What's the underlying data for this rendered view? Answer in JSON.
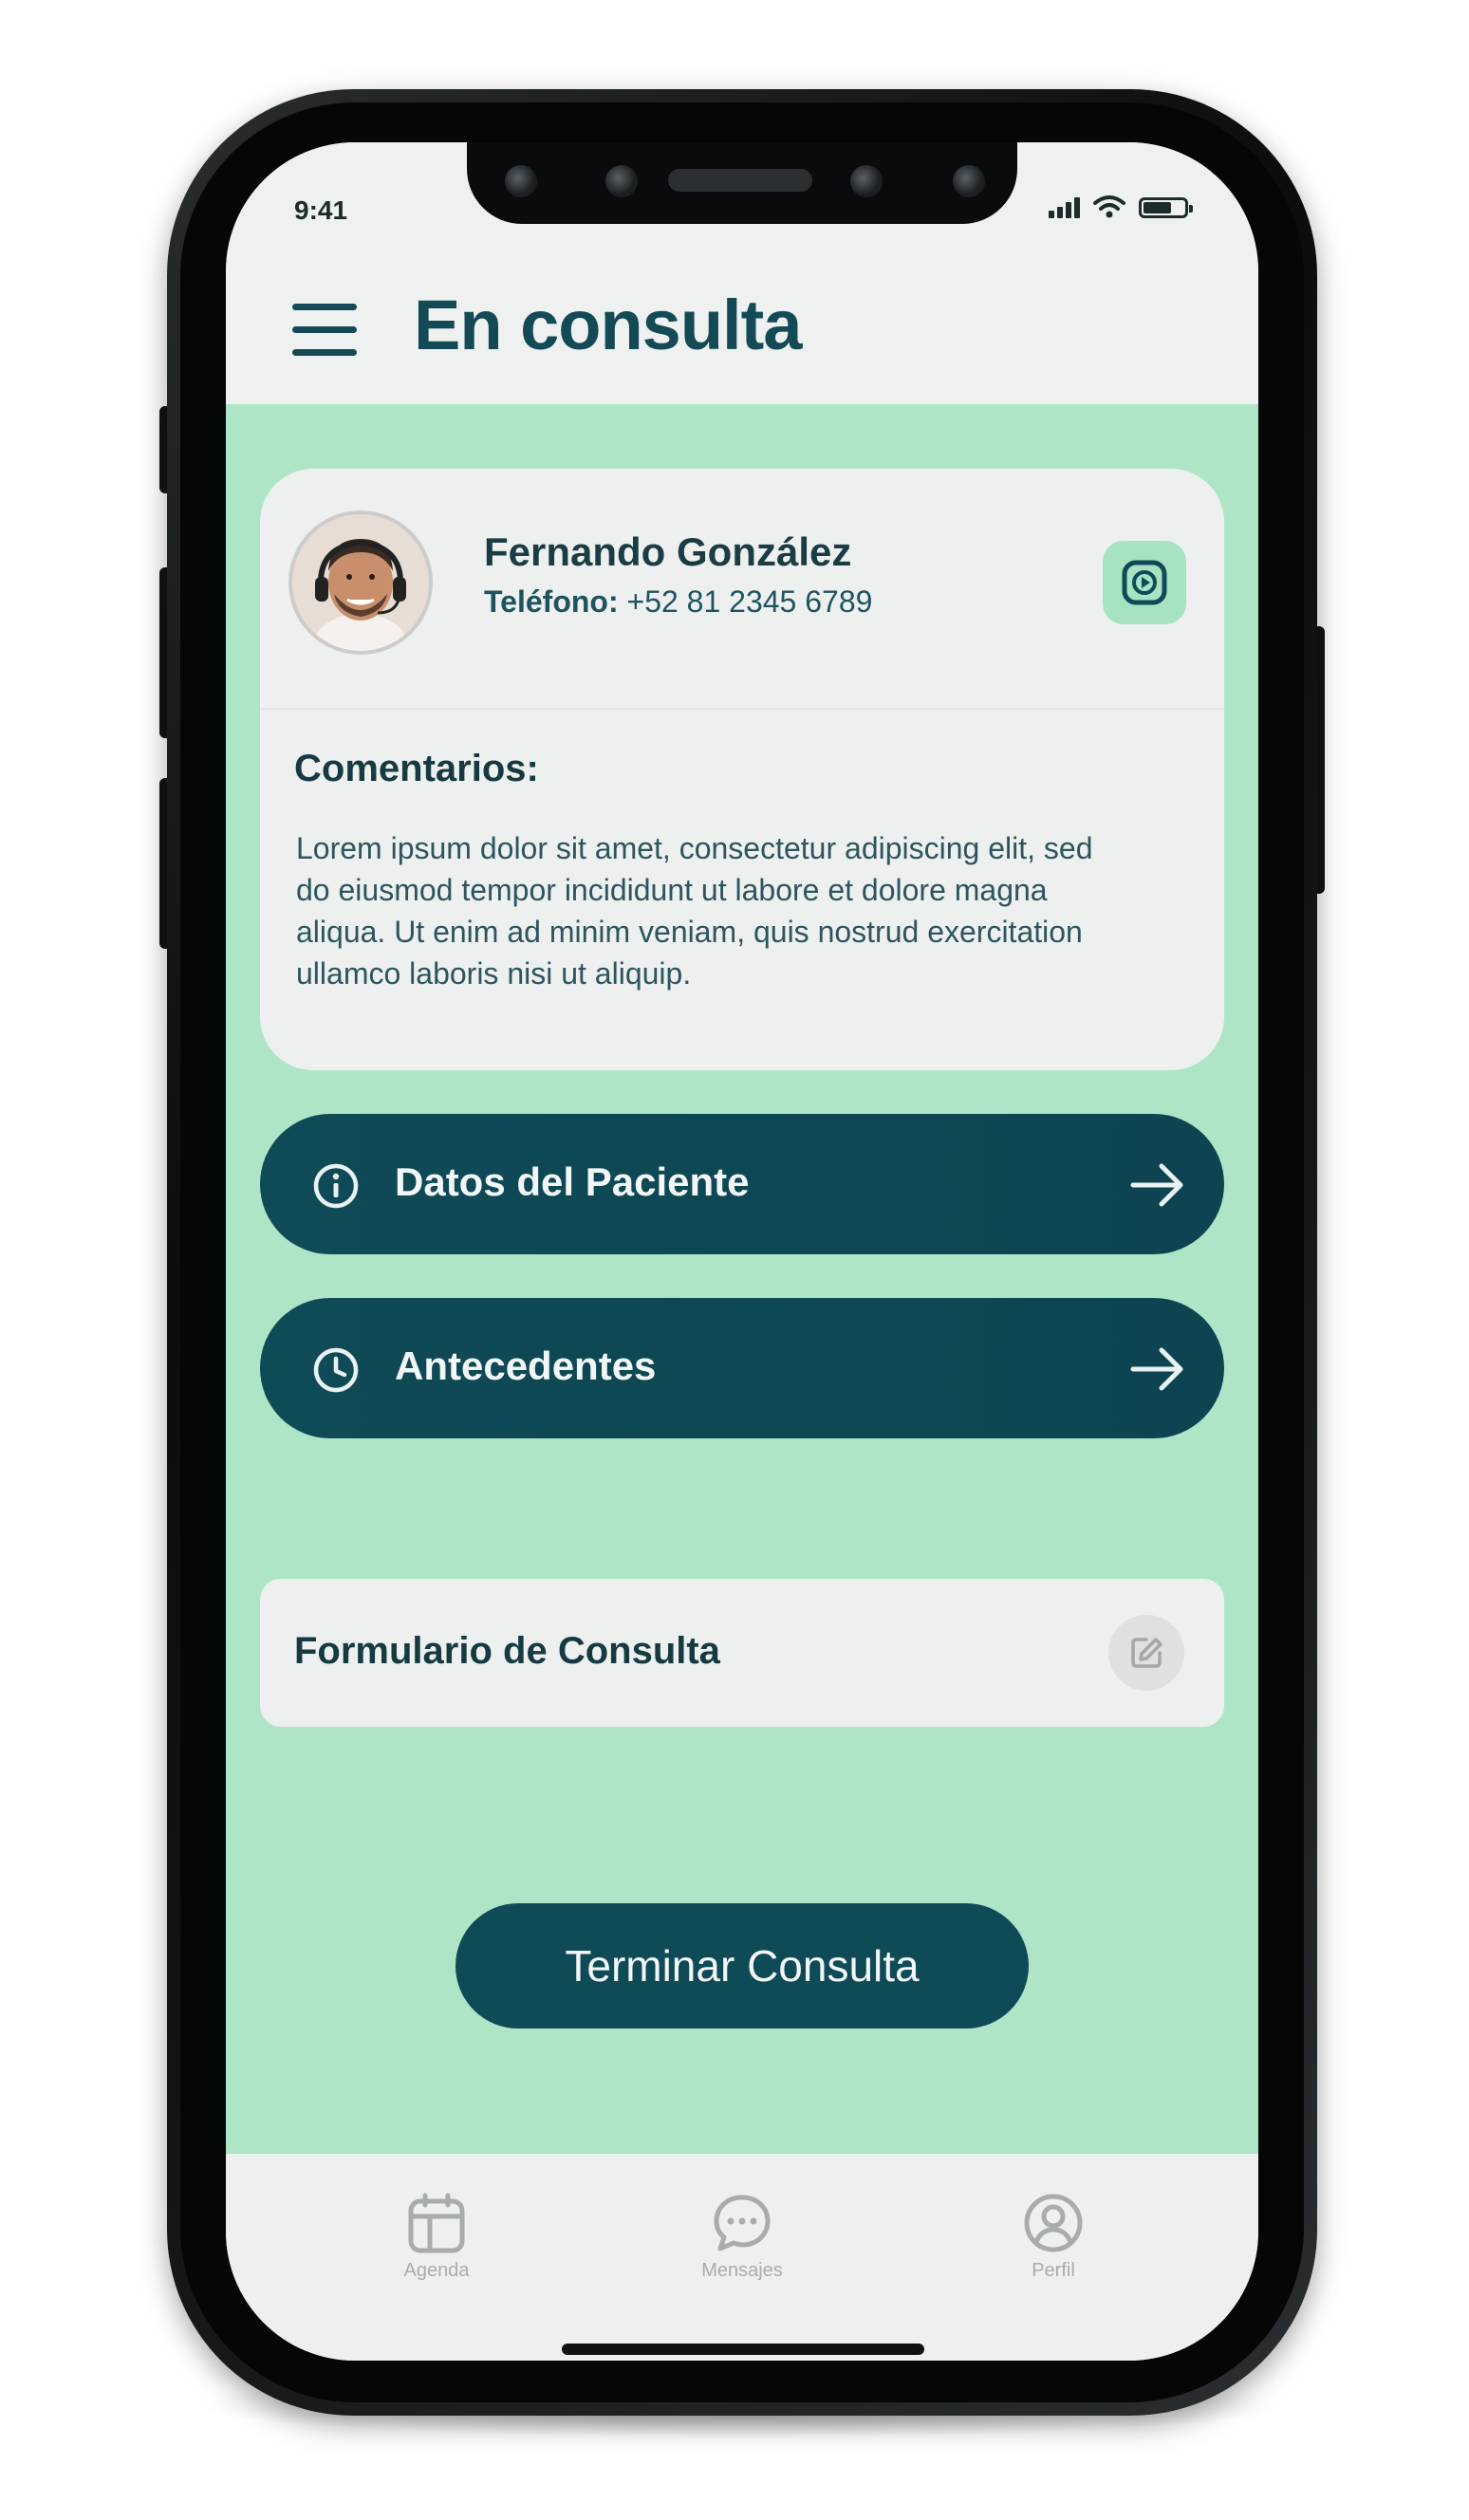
{
  "status_bar": {
    "time": "9:41"
  },
  "header": {
    "title": "En consulta"
  },
  "patient": {
    "name": "Fernando González",
    "phone_label": "Teléfono:",
    "phone": "+52 81 2345 6789"
  },
  "comments": {
    "title": "Comentarios:",
    "text": "Lorem ipsum dolor sit amet, consectetur adipiscing elit, sed do eiusmod tempor incididunt ut labore et dolore magna aliqua. Ut enim ad minim veniam, quis nostrud exercitation ullamco laboris nisi ut aliquip."
  },
  "actions": [
    {
      "label": "Datos del Paciente",
      "icon": "info-icon"
    },
    {
      "label": "Antecedentes",
      "icon": "clock-icon"
    }
  ],
  "form": {
    "label": "Formulario de Consulta",
    "icon": "edit-icon"
  },
  "end_button": {
    "label": "Terminar Consulta"
  },
  "tabs": [
    {
      "label": "Agenda",
      "icon": "calendar-icon"
    },
    {
      "label": "Mensajes",
      "icon": "chat-icon"
    },
    {
      "label": "Perfil",
      "icon": "user-circle-icon"
    }
  ],
  "colors": {
    "accent_dark": "#0f4a57",
    "background_mint": "#aee5c6",
    "card": "#eef0ef"
  }
}
